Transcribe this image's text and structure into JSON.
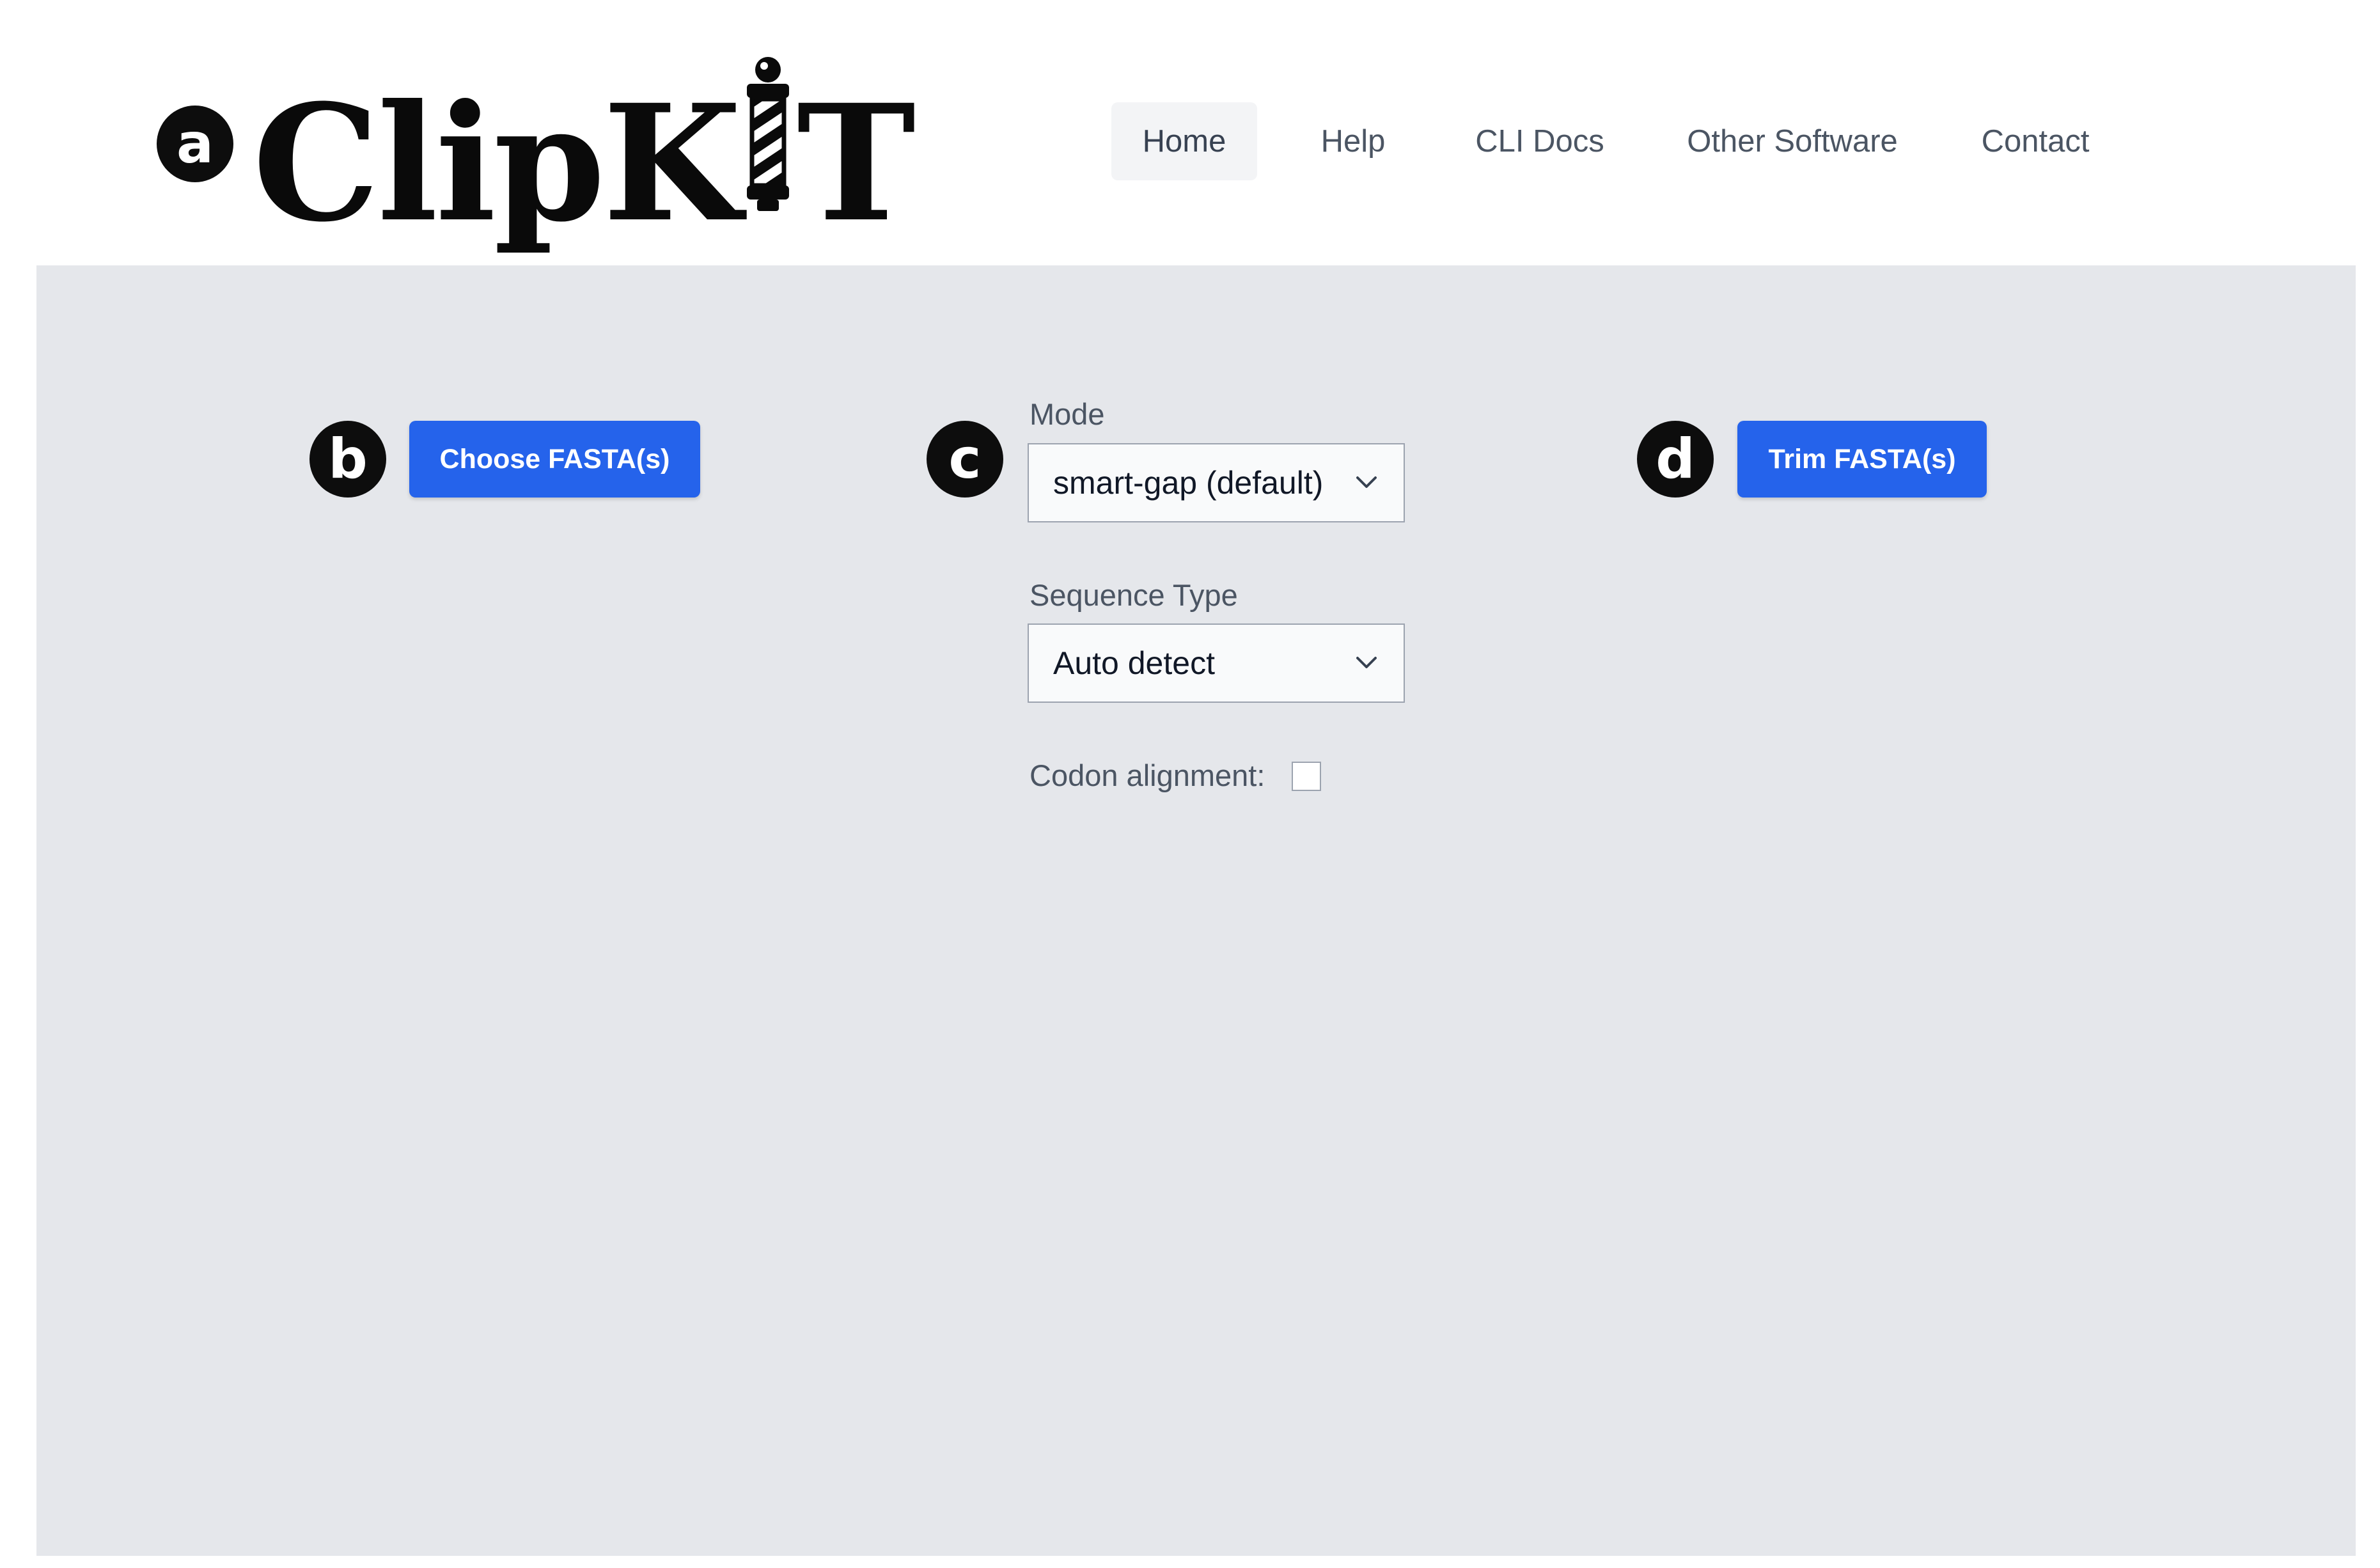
{
  "header": {
    "logo_left": "ClipK",
    "logo_right": "T",
    "nav": [
      {
        "label": "Home",
        "active": true
      },
      {
        "label": "Help",
        "active": false
      },
      {
        "label": "CLI Docs",
        "active": false
      },
      {
        "label": "Other Software",
        "active": false
      },
      {
        "label": "Contact",
        "active": false
      }
    ]
  },
  "badges": {
    "a": "a",
    "b": "b",
    "c": "c",
    "d": "d"
  },
  "main": {
    "choose_button": "Choose FASTA(s)",
    "trim_button": "Trim FASTA(s)",
    "mode": {
      "label": "Mode",
      "value": "smart-gap (default)"
    },
    "sequence_type": {
      "label": "Sequence Type",
      "value": "Auto detect"
    },
    "codon_alignment": {
      "label": "Codon alignment:",
      "checked": false
    }
  },
  "colors": {
    "primary": "#2563eb",
    "panel_bg": "#e5e7eb",
    "nav_active_bg": "#f3f4f6",
    "badge": "#0d0d0d"
  }
}
